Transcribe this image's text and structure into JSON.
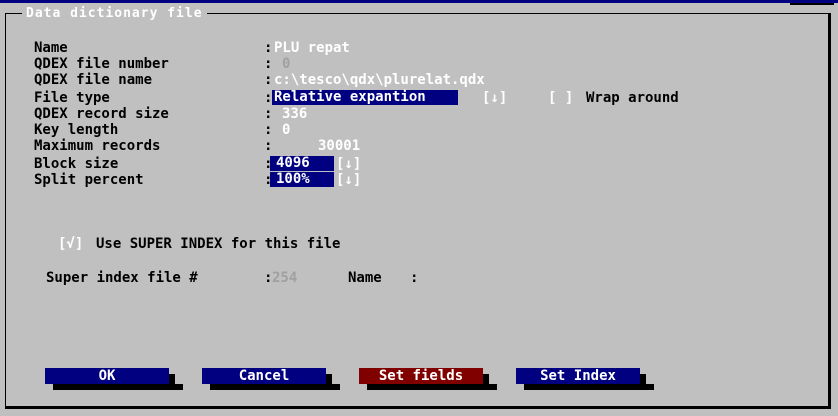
{
  "dialog": {
    "title": "Data dictionary file"
  },
  "fields": {
    "name": {
      "label": "Name",
      "value": "PLU repat"
    },
    "qdex_file_number": {
      "label": "QDEX file number",
      "value": "0"
    },
    "qdex_file_name": {
      "label": "QDEX file name",
      "value": "c:\\tesco\\qdx\\plurelat.qdx"
    },
    "file_type": {
      "label": "File type",
      "value": "Relative expantion",
      "arrow": "[↓]"
    },
    "wrap_around": {
      "checkbox": "[ ]",
      "label": "Wrap around"
    },
    "qdex_record_size": {
      "label": "QDEX record size",
      "value": "336"
    },
    "key_length": {
      "label": "Key length",
      "value": "0"
    },
    "maximum_records": {
      "label": "Maximum records",
      "value": "30001"
    },
    "block_size": {
      "label": "Block size",
      "value": "4096",
      "arrow": "[↓]"
    },
    "split_percent": {
      "label": "Split percent",
      "value": "100%",
      "arrow": "[↓]"
    }
  },
  "super_index": {
    "checkbox": "[√]",
    "label": "Use SUPER INDEX for this file",
    "file_label": "Super index file #",
    "file_value": "254",
    "name_label": "Name",
    "name_value": ""
  },
  "buttons": {
    "ok": "OK",
    "cancel": "Cancel",
    "set_fields": "Set fields",
    "set_index": "Set Index"
  },
  "colors": {
    "background": "#c0c0c0",
    "field_highlight": "#000080",
    "button_blue": "#000080",
    "button_red": "#800000"
  }
}
